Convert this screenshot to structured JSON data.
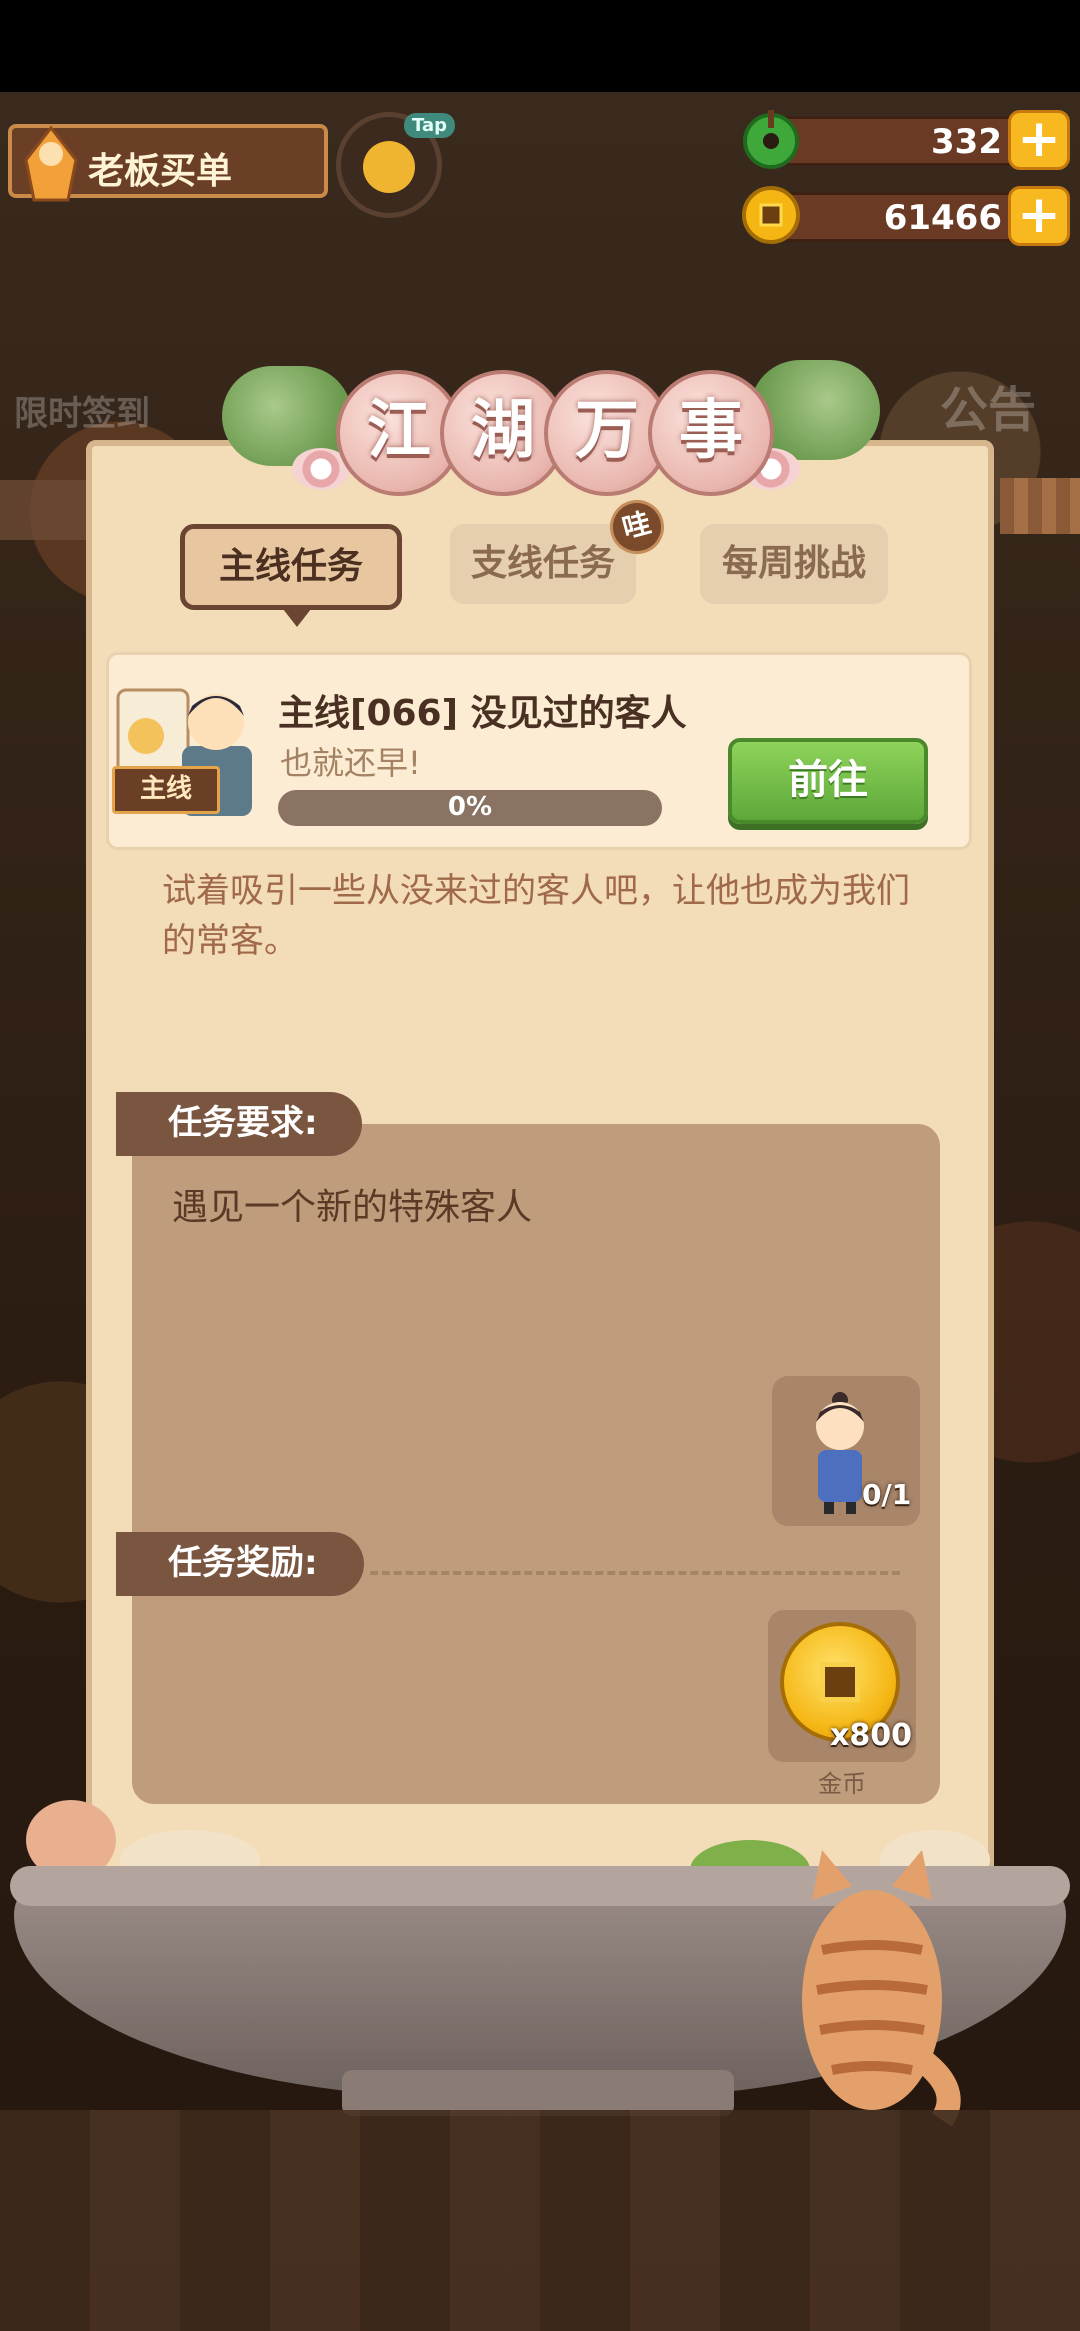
{
  "top_bar": {
    "boss_bill_label": "老板买单",
    "tap_label": "Tap"
  },
  "currency": {
    "jade": {
      "value": "332",
      "icon": "jade-icon"
    },
    "coins": {
      "value": "61466",
      "icon": "coin-icon"
    }
  },
  "background": {
    "signin_label": "限时签到",
    "notice_label": "公告"
  },
  "panel": {
    "title_chars": [
      "江",
      "湖",
      "万",
      "事"
    ],
    "tabs": [
      {
        "label": "主线任务",
        "active": true
      },
      {
        "label": "支线任务",
        "active": false,
        "badge": "哇"
      },
      {
        "label": "每周挑战",
        "active": false
      }
    ],
    "task": {
      "tag": "主线",
      "title": "主线[066] 没见过的客人",
      "subtitle": "也就还早!",
      "progress_text": "0%",
      "progress": 0,
      "go_button": "前往"
    },
    "description": "试着吸引一些从没来过的客人吧，让他也成为我们的常客。",
    "requirement": {
      "label": "任务要求:",
      "text": "遇见一个新的特殊客人",
      "count": "0/1"
    },
    "reward": {
      "label": "任务奖励:",
      "amount": "x800",
      "name": "金币"
    }
  },
  "colors": {
    "panel_bg": "#f3dcb8",
    "accent_green": "#7cc04a",
    "tab_active_border": "#6a4632",
    "coin_gold": "#f5b614"
  }
}
